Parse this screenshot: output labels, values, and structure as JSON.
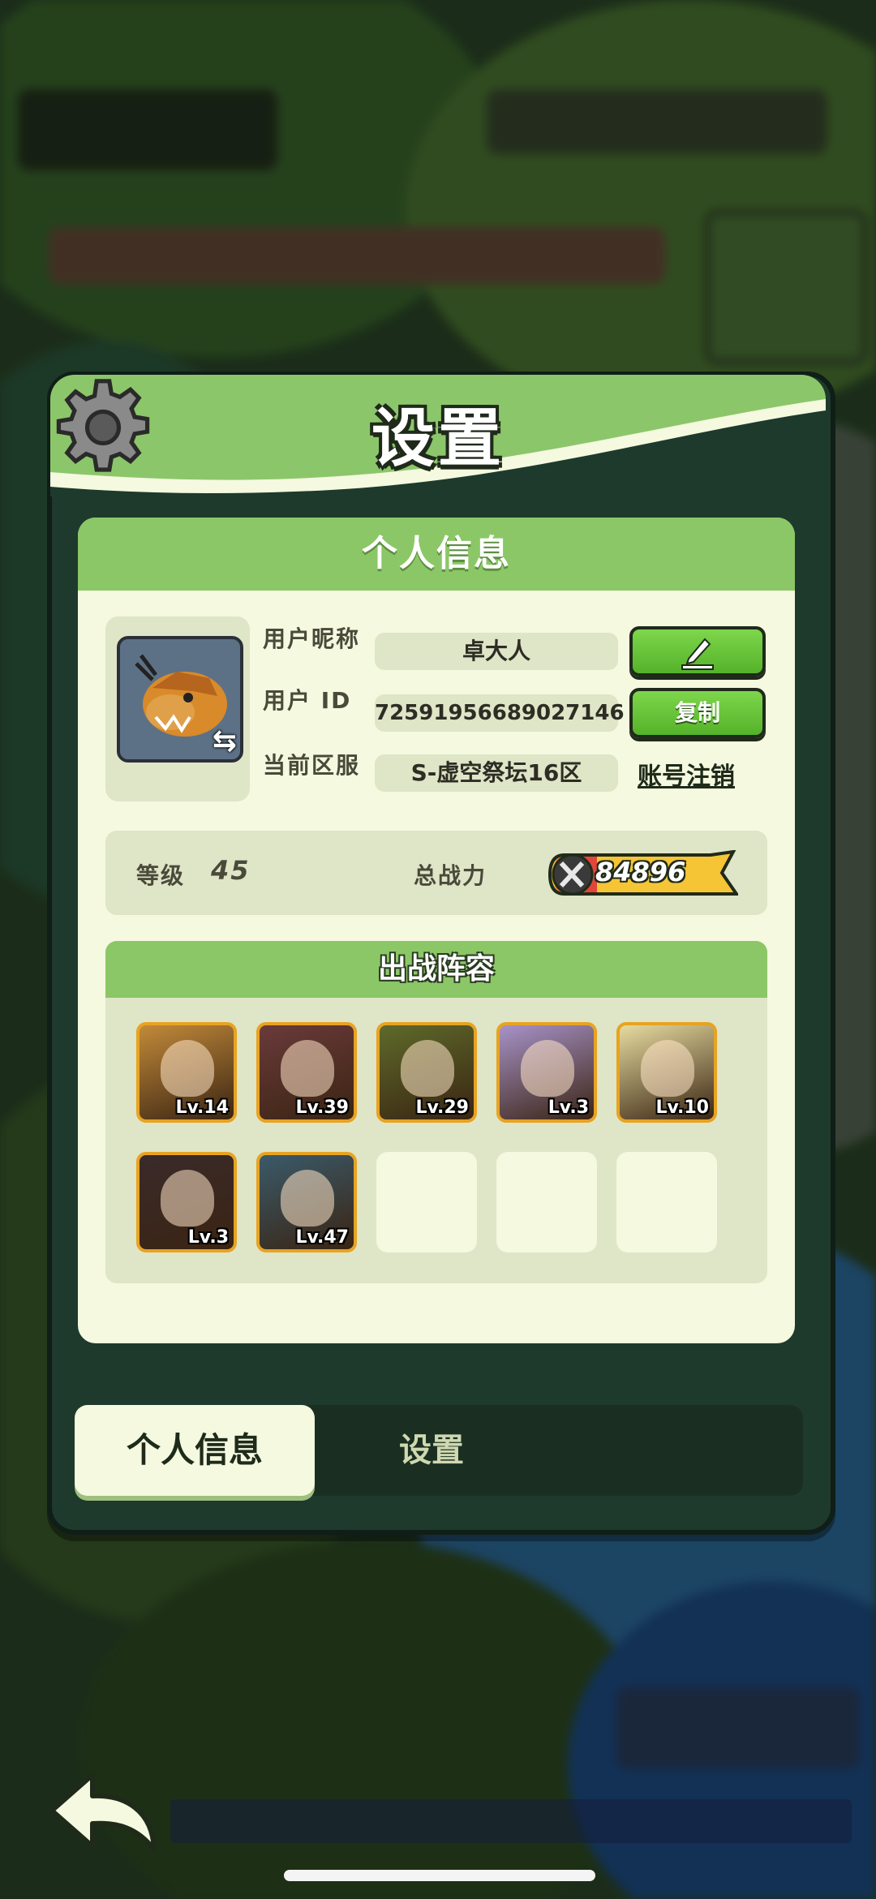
{
  "header": {
    "title": "设置"
  },
  "profile": {
    "section_title": "个人信息",
    "nickname_label": "用户昵称",
    "nickname_value": "卓大人",
    "id_label": "用户 ID",
    "id_value": "72591956689027146",
    "copy_label": "复制",
    "server_label": "当前区服",
    "server_value": "S-虚空祭坛16区",
    "cancel_account_label": "账号注销"
  },
  "stats": {
    "level_label": "等级",
    "level_value": "45",
    "power_label": "总战力",
    "power_value": "84896"
  },
  "team": {
    "title": "出战阵容",
    "heroes": [
      {
        "level": "Lv.14",
        "color": "#c28a3a"
      },
      {
        "level": "Lv.39",
        "color": "#6a3a3a"
      },
      {
        "level": "Lv.29",
        "color": "#5e6a2a"
      },
      {
        "level": "Lv.3",
        "color": "#a792c8"
      },
      {
        "level": "Lv.10",
        "color": "#e6dba0"
      },
      {
        "level": "Lv.3",
        "color": "#3a2a2a"
      },
      {
        "level": "Lv.47",
        "color": "#3a5a6a"
      }
    ],
    "empty_slots": 3
  },
  "tabs": {
    "active": "个人信息",
    "other": "设置"
  },
  "icons": [
    "gear-icon",
    "edit-icon",
    "swap-icon",
    "power-icon",
    "back-arrow-icon"
  ]
}
